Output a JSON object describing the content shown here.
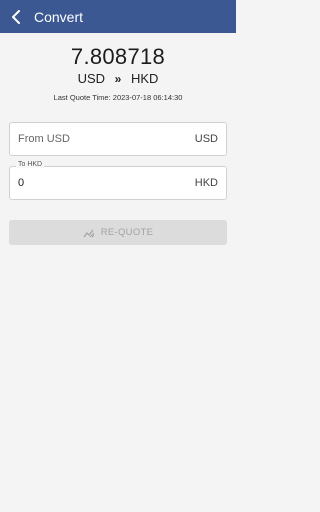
{
  "header": {
    "title": "Convert"
  },
  "quote": {
    "rate": "7.808718",
    "from_currency": "USD",
    "to_currency": "HKD",
    "arrow": "»",
    "last_quote_time": "Last Quote Time: 2023-07-18 06:14:30"
  },
  "from_field": {
    "placeholder": "From USD",
    "currency": "USD"
  },
  "to_field": {
    "label": "To HKD",
    "value": "0",
    "currency": "HKD"
  },
  "requote_button": {
    "label": "RE-QUOTE",
    "icon": "chart-refresh-icon"
  },
  "colors": {
    "appbar": "#3b5893",
    "background": "#f4f4f4",
    "button_disabled": "#dcdcdc",
    "button_text_disabled": "#a2a2a2"
  }
}
